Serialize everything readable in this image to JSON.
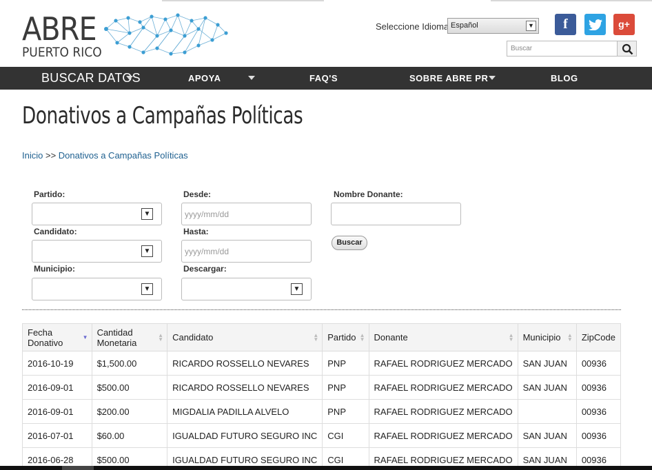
{
  "header": {
    "logo_line1": "ABRE",
    "logo_line2": "PUERTO RICO",
    "language_label": "Seleccione Idioma",
    "language_value": "Español",
    "search_placeholder": "Buscar",
    "social": {
      "facebook": "f",
      "twitter": "t",
      "googleplus": "g+"
    }
  },
  "nav": {
    "items": [
      {
        "label": "BUSCAR DATOS"
      },
      {
        "label": "APOYA"
      },
      {
        "label": "FAQ'S"
      },
      {
        "label": "SOBRE ABRE PR"
      },
      {
        "label": "BLOG"
      }
    ]
  },
  "page": {
    "title": "Donativos a Campañas Políticas",
    "breadcrumb": {
      "home": "Inicio",
      "separator": ">>",
      "current": "Donativos a Campañas Políticas"
    }
  },
  "filters": {
    "partido_label": "Partido:",
    "candidato_label": "Candidato:",
    "municipio_label": "Municipio:",
    "desde_label": "Desde:",
    "desde_placeholder": "yyyy/mm/dd",
    "hasta_label": "Hasta:",
    "hasta_placeholder": "yyyy/mm/dd",
    "descargar_label": "Descargar:",
    "donante_label": "Nombre Donante:",
    "buscar_button": "Buscar"
  },
  "table": {
    "headers": [
      "Fecha Donativo",
      "Cantidad Monetaria",
      "Candidato",
      "Partido",
      "Donante",
      "Municipio",
      "ZipCode"
    ],
    "rows": [
      [
        "2016-10-19",
        "$1,500.00",
        "RICARDO ROSSELLO NEVARES",
        "PNP",
        "RAFAEL RODRIGUEZ MERCADO",
        "SAN JUAN",
        "00936"
      ],
      [
        "2016-09-01",
        "$500.00",
        "RICARDO ROSSELLO NEVARES",
        "PNP",
        "RAFAEL RODRIGUEZ MERCADO",
        "SAN JUAN",
        "00936"
      ],
      [
        "2016-09-01",
        "$200.00",
        "MIGDALIA PADILLA ALVELO",
        "PNP",
        "RAFAEL RODRIGUEZ MERCADO",
        "",
        "00936"
      ],
      [
        "2016-07-01",
        "$60.00",
        "IGUALDAD FUTURO SEGURO INC",
        "CGI",
        "RAFAEL RODRIGUEZ MERCADO",
        "SAN JUAN",
        "00936"
      ],
      [
        "2016-06-28",
        "$500.00",
        "IGUALDAD FUTURO SEGURO INC",
        "CGI",
        "RAFAEL RODRIGUEZ MERCADO",
        "SAN JUAN",
        "00936"
      ]
    ]
  },
  "colors": {
    "nav_bg": "#333333",
    "link": "#1d5f8f",
    "facebook": "#3b5b99",
    "twitter": "#2ea3e3",
    "googleplus": "#db4b3a",
    "logo_network": "#4aa8d8"
  }
}
